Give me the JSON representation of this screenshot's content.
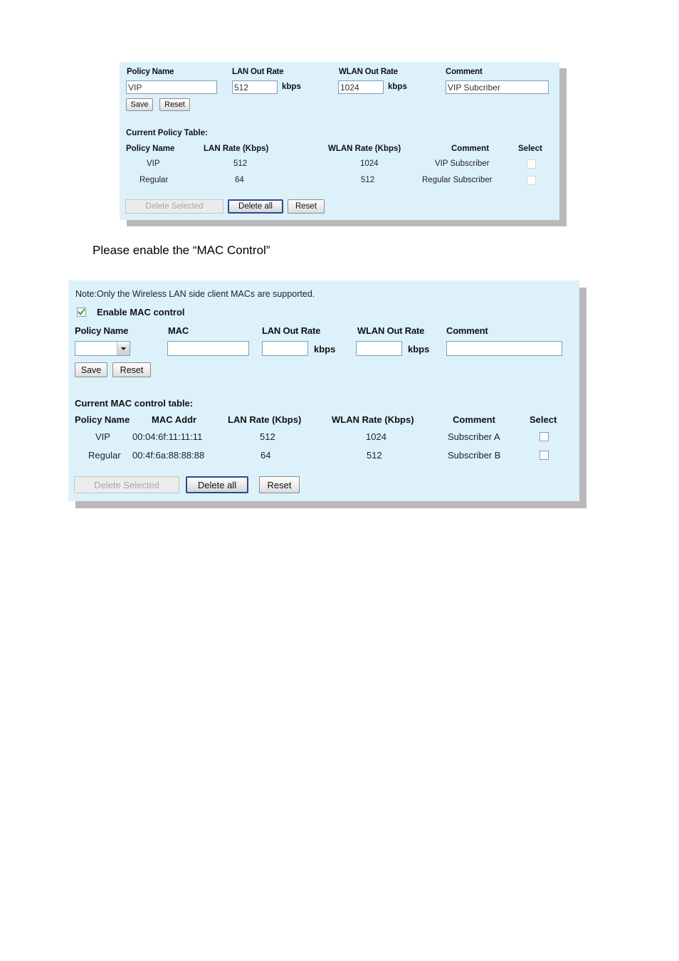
{
  "page": {
    "caption": "Please enable the “MAC Control”"
  },
  "policy_panel": {
    "form": {
      "policy_name_label": "Policy Name",
      "policy_name_value": "VIP",
      "lan_out_rate_label": "LAN Out Rate",
      "lan_out_rate_value": "512",
      "lan_unit": "kbps",
      "wlan_out_rate_label": "WLAN Out Rate",
      "wlan_out_rate_value": "1024",
      "wlan_unit": "kbps",
      "comment_label": "Comment",
      "comment_value": "VIP Subcriber",
      "save_label": "Save",
      "reset_label": "Reset"
    },
    "table": {
      "title": "Current Policy Table:",
      "headers": [
        "Policy Name",
        "LAN Rate (Kbps)",
        "WLAN Rate (Kbps)",
        "Comment",
        "Select"
      ],
      "rows": [
        {
          "policy_name": "VIP",
          "lan_rate": "512",
          "wlan_rate": "1024",
          "comment": "VIP Subscriber",
          "selected": false
        },
        {
          "policy_name": "Regular",
          "lan_rate": "64",
          "wlan_rate": "512",
          "comment": "Regular Subscriber",
          "selected": false
        }
      ],
      "delete_selected_label": "Delete Selected",
      "delete_all_label": "Delete all",
      "reset_label": "Reset"
    }
  },
  "mac_panel": {
    "note": "Note:Only the Wireless LAN side client MACs are supported.",
    "enable_checkbox_label": "Enable MAC control",
    "enable_checkbox_checked": true,
    "form": {
      "policy_name_label": "Policy Name",
      "policy_name_value": "",
      "mac_label": "MAC",
      "mac_value": "",
      "lan_out_rate_label": "LAN Out Rate",
      "lan_out_rate_value": "",
      "lan_unit": "kbps",
      "wlan_out_rate_label": "WLAN Out Rate",
      "wlan_out_rate_value": "",
      "wlan_unit": "kbps",
      "comment_label": "Comment",
      "comment_value": "",
      "save_label": "Save",
      "reset_label": "Reset"
    },
    "table": {
      "title": "Current MAC control table:",
      "headers": [
        "Policy Name",
        "MAC Addr",
        "LAN Rate (Kbps)",
        "WLAN Rate (Kbps)",
        "Comment",
        "Select"
      ],
      "rows": [
        {
          "policy_name": "VIP",
          "mac_addr": "00:04:6f:11:11:11",
          "lan_rate": "512",
          "wlan_rate": "1024",
          "comment": "Subscriber A",
          "selected": false
        },
        {
          "policy_name": "Regular",
          "mac_addr": "00:4f:6a:88:88:88",
          "lan_rate": "64",
          "wlan_rate": "512",
          "comment": "Subscriber B",
          "selected": false
        }
      ],
      "delete_selected_label": "Delete Selected",
      "delete_all_label": "Delete all",
      "reset_label": "Reset"
    }
  },
  "colors": {
    "panel_background": "#ddf1fb",
    "shadow": "#b9b9b9",
    "input_border": "#7f9db9",
    "focus_border": "#2b4a8b",
    "check_green": "#3a9e3a"
  }
}
